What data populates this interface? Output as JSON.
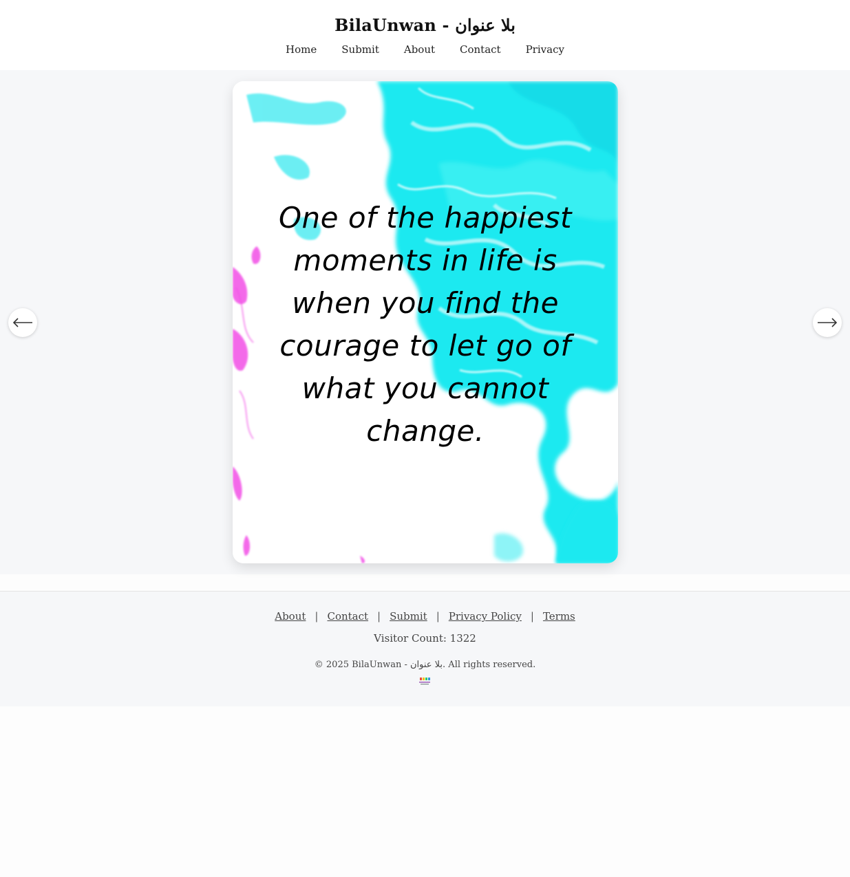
{
  "header": {
    "title": "BilaUnwan - بلا عنوان",
    "nav": [
      "Home",
      "Submit",
      "About",
      "Contact",
      "Privacy"
    ]
  },
  "slide": {
    "quote": "One of the happiest moments in life is when you find the courage to let go of what you cannot change.",
    "accent_colors": {
      "paint_cyan": "#1de9f0",
      "paint_magenta": "#f24fe6"
    }
  },
  "carousel": {
    "prev_icon": "arrow-left-icon",
    "next_icon": "arrow-right-icon"
  },
  "footer": {
    "links": [
      "About",
      "Contact",
      "Submit",
      "Privacy Policy",
      "Terms"
    ],
    "separator": "|",
    "visitor_count": "Visitor Count: 1322",
    "copyright": "© 2025 BilaUnwan - بلا عنوان. All rights reserved."
  },
  "colors": {
    "page_background": "#f6f7f9",
    "header_background": "#ffffff",
    "text": "#222222"
  }
}
